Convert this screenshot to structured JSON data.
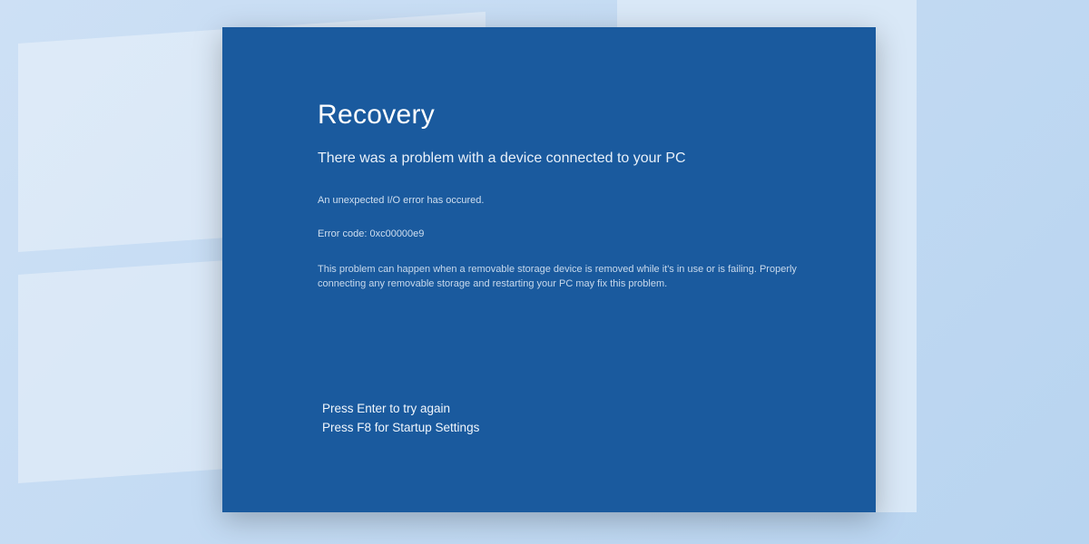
{
  "screen": {
    "title": "Recovery",
    "subtitle": "There was a problem with a device connected to your PC",
    "error_message": "An unexpected I/O error has occured.",
    "error_code_line": "Error code: 0xc00000e9",
    "explanation": "This problem can happen when a removable storage device is removed while it's in use or is failing. Properly connecting any removable storage and restarting your PC may fix this problem.",
    "instruction_retry": "Press Enter to try again",
    "instruction_settings": "Press F8 for Startup Settings"
  },
  "colors": {
    "panel_bg": "#1a5a9e",
    "page_bg": "#cde0f5",
    "text_primary": "#ffffff",
    "text_muted": "#c8d9ec"
  }
}
